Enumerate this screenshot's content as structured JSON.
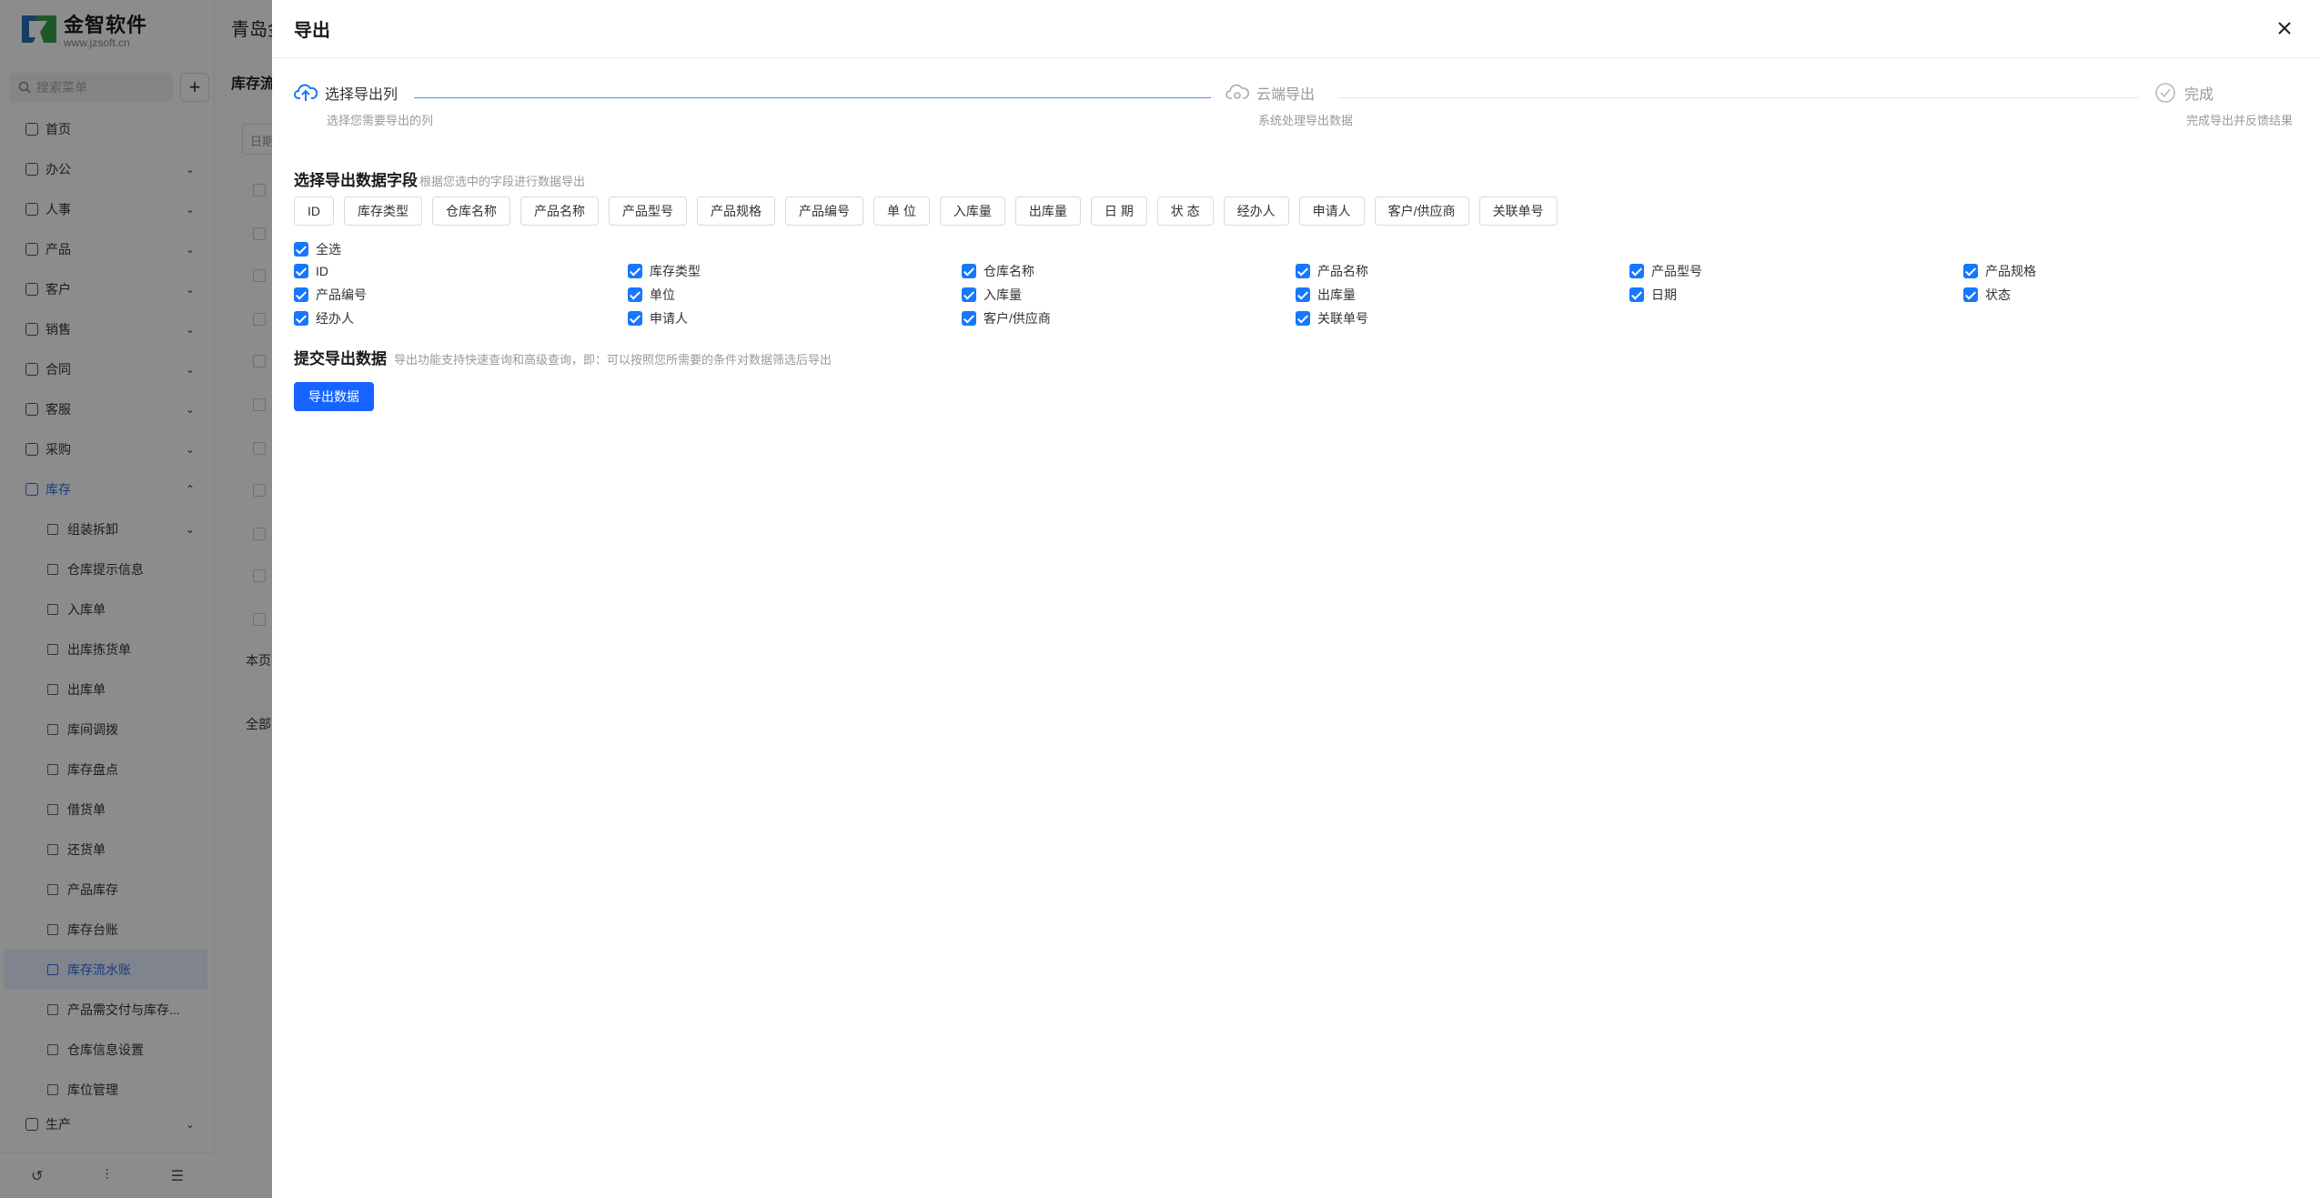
{
  "app": {
    "logo_title": "金智软件",
    "logo_sub": "www.jzsoft.cn",
    "header_title": "青岛金",
    "page_sub": "库存流",
    "filter_text": "日期",
    "footer_page": "本页",
    "footer_all": "全部"
  },
  "sidebar": {
    "search_placeholder": "搜索菜单",
    "add_label": "+",
    "items": [
      {
        "label": "首页"
      },
      {
        "label": "办公"
      },
      {
        "label": "人事"
      },
      {
        "label": "产品"
      },
      {
        "label": "客户"
      },
      {
        "label": "销售"
      },
      {
        "label": "合同"
      },
      {
        "label": "客服"
      },
      {
        "label": "采购"
      },
      {
        "label": "库存"
      }
    ],
    "sub_items": [
      {
        "label": "组装拆卸"
      },
      {
        "label": "仓库提示信息"
      },
      {
        "label": "入库单"
      },
      {
        "label": "出库拣货单"
      },
      {
        "label": "出库单"
      },
      {
        "label": "库间调拨"
      },
      {
        "label": "库存盘点"
      },
      {
        "label": "借货单"
      },
      {
        "label": "还货单"
      },
      {
        "label": "产品库存"
      },
      {
        "label": "库存台账"
      },
      {
        "label": "库存流水账"
      },
      {
        "label": "产品需交付与库存..."
      },
      {
        "label": "仓库信息设置"
      },
      {
        "label": "库位管理"
      }
    ],
    "last_item": "生产"
  },
  "drawer": {
    "title": "导出",
    "steps": [
      {
        "title": "选择导出列",
        "desc": "选择您需要导出的列"
      },
      {
        "title": "云端导出",
        "desc": "系统处理导出数据"
      },
      {
        "title": "完成",
        "desc": "完成导出并反馈结果"
      }
    ],
    "fields_section": {
      "title": "选择导出数据字段",
      "hint": "根据您选中的字段进行数据导出"
    },
    "tags": [
      "ID",
      "库存类型",
      "仓库名称",
      "产品名称",
      "产品型号",
      "产品规格",
      "产品编号",
      "单 位",
      "入库量",
      "出库量",
      "日 期",
      "状 态",
      "经办人",
      "申请人",
      "客户/供应商",
      "关联单号"
    ],
    "select_all": "全选",
    "checkboxes": [
      "ID",
      "库存类型",
      "仓库名称",
      "产品名称",
      "产品型号",
      "产品规格",
      "产品编号",
      "单位",
      "入库量",
      "出库量",
      "日期",
      "状态",
      "经办人",
      "申请人",
      "客户/供应商",
      "关联单号"
    ],
    "submit_section": {
      "title": "提交导出数据",
      "hint": "导出功能支持快速查询和高级查询，即：可以按照您所需要的条件对数据筛选后导出"
    },
    "export_button": "导出数据"
  },
  "colors": {
    "primary": "#1664ff",
    "checkbox": "#1677ff",
    "active_nav": "#2f6fef",
    "step_line_active": "#4a8ee8"
  }
}
